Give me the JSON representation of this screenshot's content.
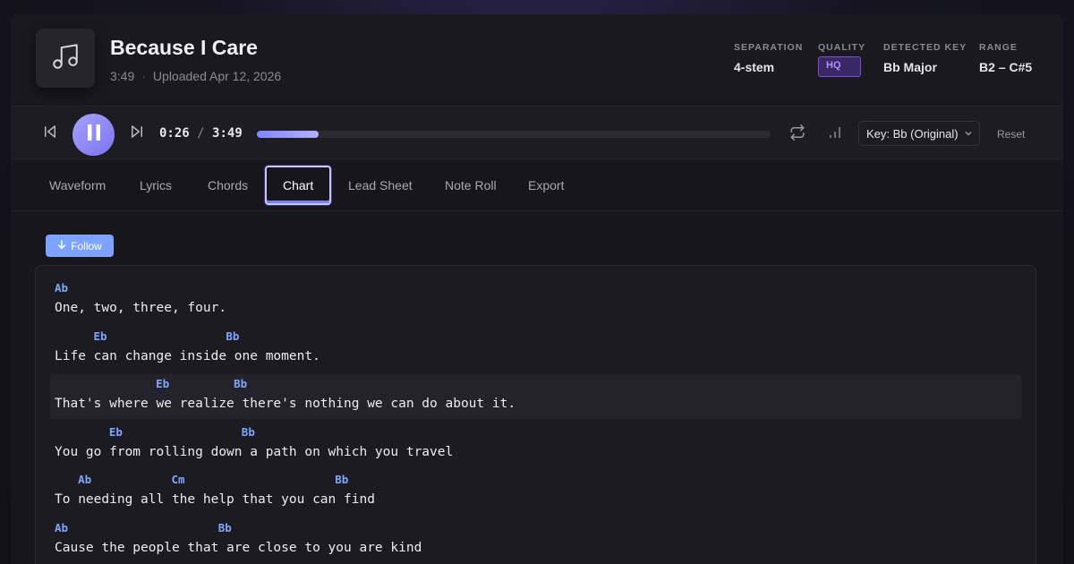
{
  "track": {
    "title": "Because I Care",
    "duration": "3:49",
    "separator": "·",
    "uploaded": "Uploaded Apr 12, 2026",
    "art_icon": "music-note-icon"
  },
  "meta": {
    "separation_label": "SEPARATION",
    "separation_value": "4-stem",
    "quality_label": "QUALITY",
    "quality_value": "HQ",
    "key_label": "DETECTED KEY",
    "key_value": "Bb Major",
    "range_label": "RANGE",
    "range_value": "B2 – C#5"
  },
  "transport": {
    "current_time": "0:26",
    "time_sep": "/",
    "total_time": "3:49",
    "progress": 0.12,
    "key_select": "Key: Bb (Original)",
    "reset_label": "Reset",
    "icons": [
      "skip-back-icon",
      "pause-icon",
      "skip-forward-icon",
      "repeat-icon",
      "level-icon",
      "chevron-down-icon"
    ]
  },
  "tabs": [
    {
      "label": "Waveform"
    },
    {
      "label": "Lyrics"
    },
    {
      "label": "Chords"
    },
    {
      "label": "Chart",
      "active": true
    },
    {
      "label": "Lead Sheet"
    },
    {
      "label": "Note Roll"
    },
    {
      "label": "Export"
    }
  ],
  "follow_label": "Follow",
  "sheet": {
    "lines": [
      {
        "chords": [
          {
            "name": "Ab",
            "col": 0
          }
        ],
        "lyric": "One, two, three, four."
      },
      {
        "chords": [
          {
            "name": "Eb",
            "col": 5
          },
          {
            "name": "Bb",
            "col": 22
          }
        ],
        "lyric": "Life can change inside one moment."
      },
      {
        "chords": [
          {
            "name": "Eb",
            "col": 13
          },
          {
            "name": "Bb",
            "col": 23
          }
        ],
        "lyric": "That's where we realize there's nothing we can do about it.",
        "highlight": true
      },
      {
        "chords": [
          {
            "name": "Eb",
            "col": 7
          },
          {
            "name": "Bb",
            "col": 24
          }
        ],
        "lyric": "You go from rolling down a path on which you travel"
      },
      {
        "chords": [
          {
            "name": "Ab",
            "col": 3
          },
          {
            "name": "Cm",
            "col": 15
          },
          {
            "name": "Bb",
            "col": 36
          }
        ],
        "lyric": "To needing all the help that you can find"
      },
      {
        "chords": [
          {
            "name": "Ab",
            "col": 0
          },
          {
            "name": "Bb",
            "col": 21
          }
        ],
        "lyric": "Cause the people that are close to you are kind"
      }
    ]
  }
}
